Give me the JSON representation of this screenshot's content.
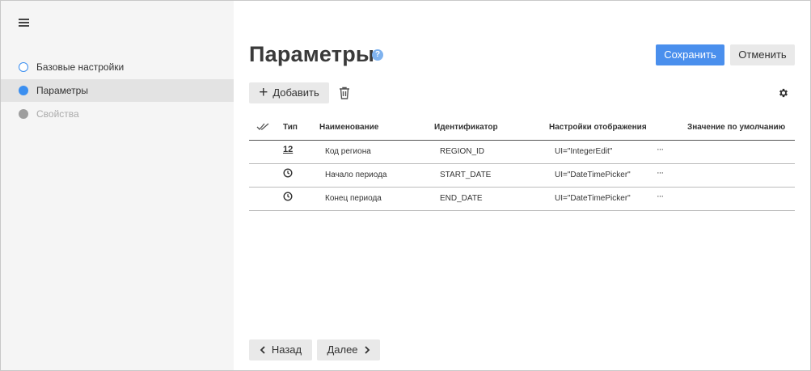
{
  "sidebar": {
    "menu_icon": "hamburger-menu-icon",
    "steps": [
      {
        "label": "Базовые настройки",
        "state": "done"
      },
      {
        "label": "Параметры",
        "state": "active"
      },
      {
        "label": "Свойства",
        "state": "disabled"
      }
    ]
  },
  "header": {
    "title": "Параметры",
    "help_symbol": "?",
    "save_label": "Сохранить",
    "cancel_label": "Отменить"
  },
  "toolbar": {
    "add_symbol": "+",
    "add_label": "Добавить",
    "delete_icon": "trash-icon",
    "settings_icon": "gear-icon"
  },
  "table": {
    "select_all_icon": "double-check-icon",
    "columns": [
      "Тип",
      "Наименование",
      "Идентификатор",
      "Настройки отображения",
      "Значение по умолчанию"
    ],
    "rows": [
      {
        "type_icon": "integer-type-icon",
        "type_text": "12",
        "name": "Код региона",
        "identifier": "REGION_ID",
        "display": "UI=\"IntegerEdit\"",
        "more": "···",
        "default": ""
      },
      {
        "type_icon": "clock-icon",
        "type_text": "",
        "name": "Начало периода",
        "identifier": "START_DATE",
        "display": "UI=\"DateTimePicker\"",
        "more": "···",
        "default": ""
      },
      {
        "type_icon": "clock-icon",
        "type_text": "",
        "name": "Конец периода",
        "identifier": "END_DATE",
        "display": "UI=\"DateTimePicker\"",
        "more": "···",
        "default": ""
      }
    ]
  },
  "footer": {
    "back_label": "Назад",
    "next_label": "Далее"
  },
  "colors": {
    "accent": "#4a8fed",
    "sidebar_bg": "#f5f5f5",
    "active_step_bg": "#e3e3e3",
    "disabled_dot": "#9e9e9e"
  }
}
